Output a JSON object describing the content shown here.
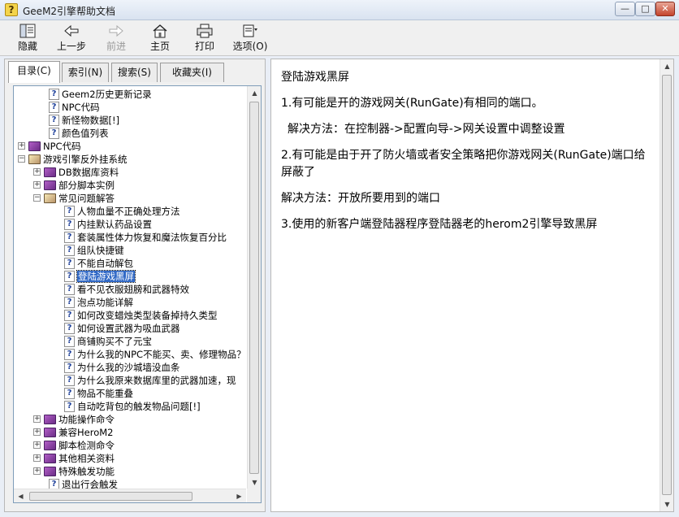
{
  "window": {
    "title": "GeeM2引擎帮助文档",
    "min_label": "—",
    "max_label": "□",
    "close_label": "✕"
  },
  "toolbar": {
    "hide": "隐藏",
    "back": "上一步",
    "forward": "前进",
    "home": "主页",
    "print": "打印",
    "options": "选项(O)"
  },
  "tabs": {
    "contents": "目录(C)",
    "index": "索引(N)",
    "search": "搜索(S)",
    "favorites": "收藏夹(I)"
  },
  "tree": [
    {
      "text": "Geem2历史更新记录",
      "type": "topic"
    },
    {
      "text": "NPC代码",
      "type": "topic"
    },
    {
      "text": "新怪物数据[!]",
      "type": "topic"
    },
    {
      "text": "颜色值列表",
      "type": "topic"
    },
    {
      "text": "NPC代码",
      "type": "book",
      "expander": "+"
    },
    {
      "text": "游戏引擎反外挂系统",
      "type": "book-open",
      "expander": "−"
    },
    {
      "text": "DB数据库资料",
      "type": "book",
      "expander": "+"
    },
    {
      "text": "部分脚本实例",
      "type": "book",
      "expander": "+"
    },
    {
      "text": "常见问题解答",
      "type": "book-open",
      "expander": "−"
    },
    {
      "text": "人物血量不正确处理方法",
      "type": "topic"
    },
    {
      "text": "内挂默认药品设置",
      "type": "topic"
    },
    {
      "text": "套装属性体力恢复和魔法恢复百分比",
      "type": "topic"
    },
    {
      "text": "组队快捷键",
      "type": "topic"
    },
    {
      "text": "不能自动解包",
      "type": "topic"
    },
    {
      "text": "登陆游戏黑屏",
      "type": "topic",
      "selected": true
    },
    {
      "text": "看不见衣服翅膀和武器特效",
      "type": "topic"
    },
    {
      "text": "泡点功能详解",
      "type": "topic"
    },
    {
      "text": "如何改变蜡烛类型装备掉持久类型",
      "type": "topic"
    },
    {
      "text": "如何设置武器为吸血武器",
      "type": "topic"
    },
    {
      "text": "商铺购买不了元宝",
      "type": "topic"
    },
    {
      "text": "为什么我的NPC不能买、卖、修理物品？",
      "type": "topic"
    },
    {
      "text": "为什么我的沙城墙没血条",
      "type": "topic"
    },
    {
      "text": "为什么我原来数据库里的武器加速，现",
      "type": "topic"
    },
    {
      "text": "物品不能重叠",
      "type": "topic"
    },
    {
      "text": "自动吃背包的触发物品问题[!]",
      "type": "topic"
    },
    {
      "text": "功能操作命令",
      "type": "book",
      "expander": "+"
    },
    {
      "text": "兼容HeroM2",
      "type": "book",
      "expander": "+"
    },
    {
      "text": "脚本检测命令",
      "type": "book",
      "expander": "+"
    },
    {
      "text": "其他相关资料",
      "type": "book",
      "expander": "+"
    },
    {
      "text": "特殊触发功能",
      "type": "book",
      "expander": "+"
    },
    {
      "text": "退出行会触发",
      "type": "topic"
    }
  ],
  "content": {
    "title": "登陆游戏黑屏",
    "p1": "1.有可能是开的游戏网关(RunGate)有相同的端口。",
    "p2": "解决方法：在控制器->配置向导->网关设置中调整设置",
    "p3": "2.有可能是由于开了防火墙或者安全策略把你游戏网关(RunGate)端口给屏蔽了",
    "p4": "解决方法：开放所要用到的端口",
    "p5": "3.使用的新客户端登陆器程序登陆器老的herom2引擎导致黑屏"
  }
}
